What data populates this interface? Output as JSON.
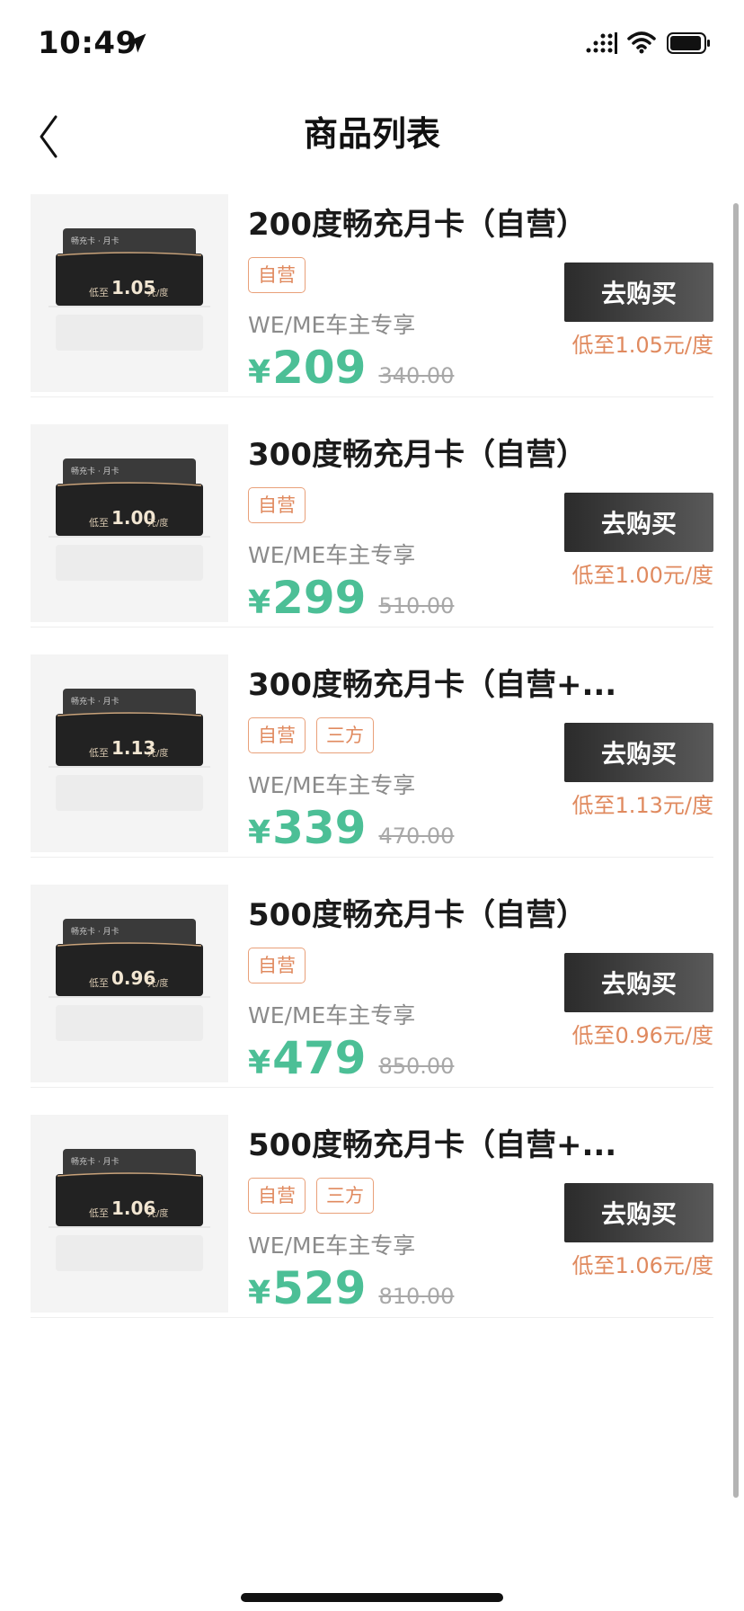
{
  "status_bar": {
    "time": "10:49",
    "icons": [
      "location-arrow-icon",
      "signal-icon",
      "wifi-icon",
      "battery-icon"
    ]
  },
  "nav": {
    "title": "商品列表",
    "back_icon": "chevron-left-icon"
  },
  "products": [
    {
      "title": "200度畅充月卡（自营）",
      "tags": [
        "自营"
      ],
      "desc": "WE/ME车主专享",
      "currency": "¥",
      "price": "209",
      "original_price": "340.00",
      "buy_label": "去购买",
      "unit_price": "低至1.05元/度",
      "thumb_label": "畅充卡 · 月卡",
      "thumb_prefix": "低至",
      "thumb_value": "1.05",
      "thumb_unit": "元/度"
    },
    {
      "title": "300度畅充月卡（自营）",
      "tags": [
        "自营"
      ],
      "desc": "WE/ME车主专享",
      "currency": "¥",
      "price": "299",
      "original_price": "510.00",
      "buy_label": "去购买",
      "unit_price": "低至1.00元/度",
      "thumb_label": "畅充卡 · 月卡",
      "thumb_prefix": "低至",
      "thumb_value": "1.00",
      "thumb_unit": "元/度"
    },
    {
      "title": "300度畅充月卡（自营+...",
      "tags": [
        "自营",
        "三方"
      ],
      "desc": "WE/ME车主专享",
      "currency": "¥",
      "price": "339",
      "original_price": "470.00",
      "buy_label": "去购买",
      "unit_price": "低至1.13元/度",
      "thumb_label": "畅充卡 · 月卡",
      "thumb_prefix": "低至",
      "thumb_value": "1.13",
      "thumb_unit": "元/度"
    },
    {
      "title": "500度畅充月卡（自营）",
      "tags": [
        "自营"
      ],
      "desc": "WE/ME车主专享",
      "currency": "¥",
      "price": "479",
      "original_price": "850.00",
      "buy_label": "去购买",
      "unit_price": "低至0.96元/度",
      "thumb_label": "畅充卡 · 月卡",
      "thumb_prefix": "低至",
      "thumb_value": "0.96",
      "thumb_unit": "元/度"
    },
    {
      "title": "500度畅充月卡（自营+...",
      "tags": [
        "自营",
        "三方"
      ],
      "desc": "WE/ME车主专享",
      "currency": "¥",
      "price": "529",
      "original_price": "810.00",
      "buy_label": "去购买",
      "unit_price": "低至1.06元/度",
      "thumb_label": "畅充卡 · 月卡",
      "thumb_prefix": "低至",
      "thumb_value": "1.06",
      "thumb_unit": "元/度"
    }
  ],
  "colors": {
    "price_green": "#4cbf96",
    "accent_orange": "#e08a5f",
    "button_dark": "#2b2b2b"
  }
}
